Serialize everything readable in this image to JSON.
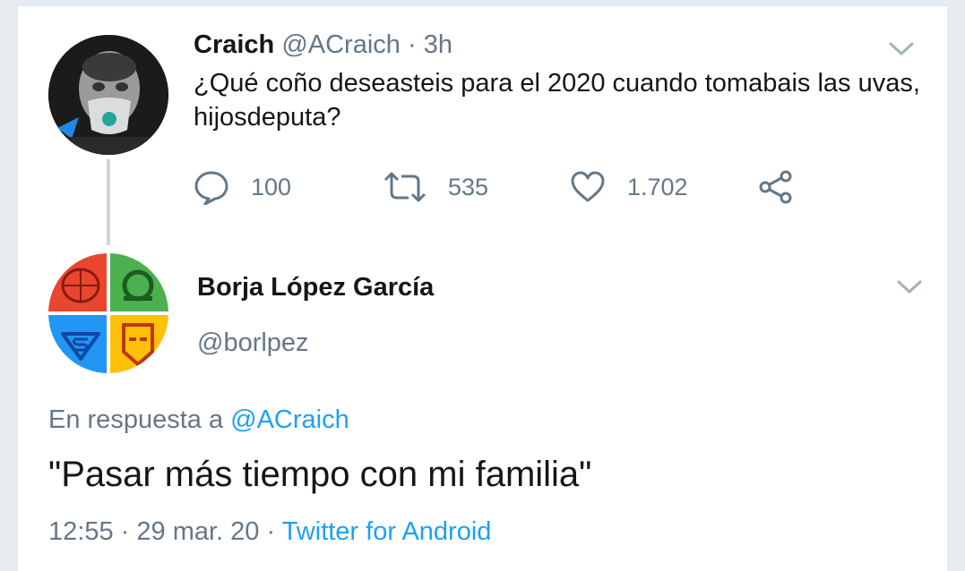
{
  "tweet": {
    "author_name": "Craich",
    "author_handle": "@ACraich",
    "separator": "·",
    "time": "3h",
    "text": "¿Qué coño deseasteis para el 2020 cuando tomabais las uvas, hijosdeputa?",
    "replies": "100",
    "retweets": "535",
    "likes": "1.702"
  },
  "reply": {
    "author_name": "Borja López García",
    "author_handle": "@borlpez",
    "in_reply_to_prefix": "En respuesta a",
    "in_reply_to_handle": "@ACraich",
    "text": "\"Pasar más tiempo con mi familia\"",
    "time": "12:55",
    "separator": "·",
    "date": "29 mar. 20",
    "source": "Twitter for Android"
  },
  "colors": {
    "background": "#e6ecf0",
    "text": "#14171a",
    "muted": "#657786",
    "link": "#1da1f2",
    "spiderman": "#e9452f",
    "green_lantern": "#4caf50",
    "superman": "#2196f3",
    "iron_man": "#ffc107"
  },
  "icons": {
    "reply": "speech-bubble-icon",
    "retweet": "retweet-arrows-icon",
    "like": "heart-icon",
    "share": "share-nodes-icon",
    "more": "chevron-down-icon"
  }
}
